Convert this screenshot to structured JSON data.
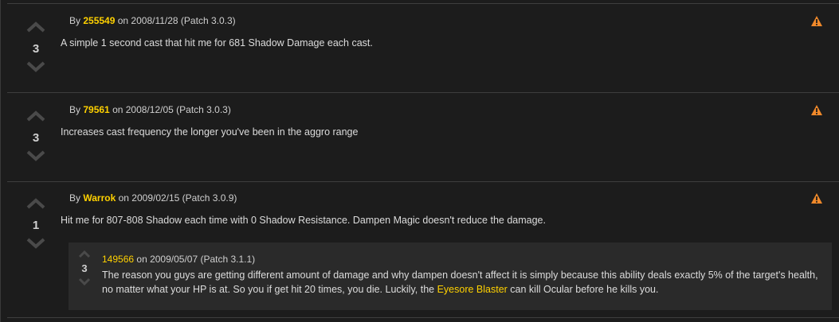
{
  "comments": [
    {
      "score": "3",
      "by": "By",
      "user": "255549",
      "meta_rest": "on 2008/11/28 (Patch 3.0.3)",
      "text": "A simple 1 second cast that hit me for 681 Shadow Damage each cast."
    },
    {
      "score": "3",
      "by": "By",
      "user": "79561",
      "meta_rest": "on 2008/12/05 (Patch 3.0.3)",
      "text": "Increases cast frequency the longer you've been in the aggro range"
    },
    {
      "score": "1",
      "by": "By",
      "user": "Warrok",
      "meta_rest": "on 2009/02/15 (Patch 3.0.9)",
      "text": "Hit me for 807-808 Shadow each time with 0 Shadow Resistance. Dampen Magic doesn't reduce the damage."
    }
  ],
  "reply": {
    "score": "3",
    "user": "149566",
    "meta_rest": "on 2009/05/07 (Patch 3.1.1)",
    "text_before": "The reason you guys are getting different amount of damage and why dampen doesn't affect it is simply because this ability deals exactly 5% of the target's health, no matter what your HP is at. So you if get hit 20 times, you die. Luckily, the ",
    "link": "Eyesore Blaster",
    "text_after": " can kill Ocular before he kills you."
  },
  "colors": {
    "accent": "#ffd100",
    "warning": "#f0892a",
    "background": "#1c1c1c",
    "reply_background": "#2a2a2a"
  },
  "icons": {
    "upvote": "chevron-up-icon",
    "downvote": "chevron-down-icon",
    "report": "warning-icon"
  }
}
